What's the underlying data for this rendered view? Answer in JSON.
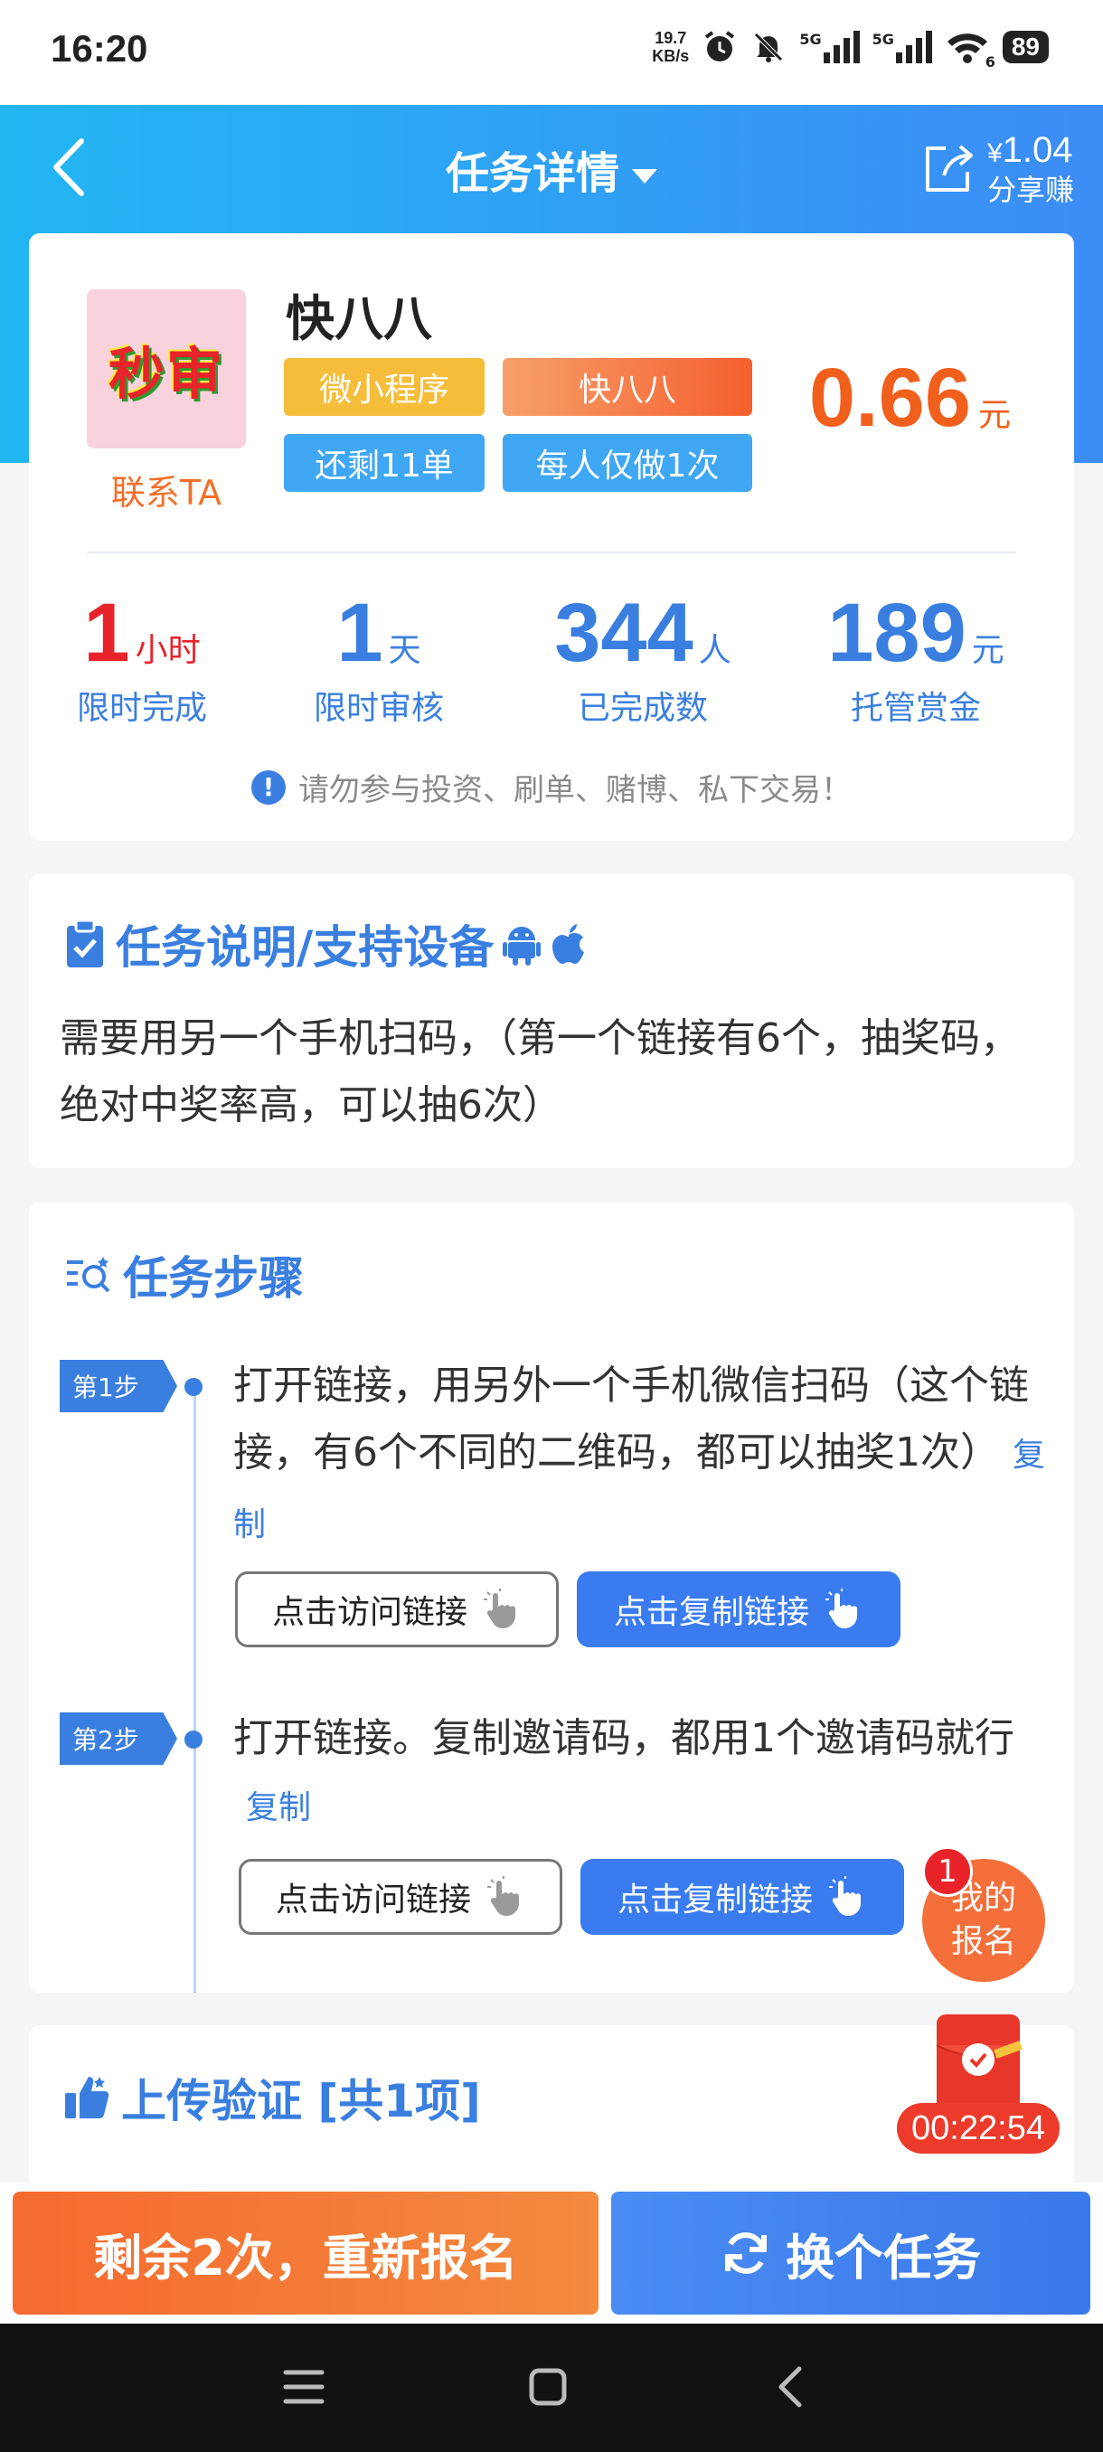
{
  "status": {
    "time": "16:20",
    "speed_value": "19.7",
    "speed_unit": "KB/s",
    "sim1": "5G",
    "sim2": "5G",
    "wifi_label": "6",
    "battery": "89"
  },
  "header": {
    "title": "任务详情",
    "share_currency": "¥",
    "share_amount": "1.04",
    "share_label": "分享赚"
  },
  "task": {
    "logo_text": "秒审",
    "contact_label": "联系TA",
    "name": "快八八",
    "tags": [
      "微小程序",
      "快八八",
      "还剩11单",
      "每人仅做1次"
    ],
    "price": "0.66",
    "price_unit": "元",
    "stats": [
      {
        "value": "1",
        "unit": "小时",
        "label": "限时完成",
        "color": "#e8232a"
      },
      {
        "value": "1",
        "unit": "天",
        "label": "限时审核",
        "color": "#3a7fe0"
      },
      {
        "value": "344",
        "unit": "人",
        "label": "已完成数",
        "color": "#3a7fe0"
      },
      {
        "value": "189",
        "unit": "元",
        "label": "托管赏金",
        "color": "#3a7fe0"
      }
    ],
    "warning": "请勿参与投资、刷单、赌博、私下交易！"
  },
  "description": {
    "title": "任务说明/支持设备",
    "text": "需要用另一个手机扫码，（第一个链接有6个，抽奖码，绝对中奖率高，可以抽6次）"
  },
  "steps": {
    "title": "任务步骤",
    "items": [
      {
        "badge": "第1步",
        "text": "打开链接，用另外一个手机微信扫码（这个链接，有6个不同的二维码，都可以抽奖1次）",
        "copy": "复制",
        "visit_btn": "点击访问链接",
        "copy_btn": "点击复制链接"
      },
      {
        "badge": "第2步",
        "text": "打开链接。复制邀请码，都用1个邀请码就行",
        "copy": "复制",
        "visit_btn": "点击访问链接",
        "copy_btn": "点击复制链接"
      }
    ]
  },
  "upload": {
    "title": "上传验证 [共1项]"
  },
  "floating": {
    "badge_count": "1",
    "register_label": "我的报名",
    "timer": "00:22:54"
  },
  "bottom": {
    "left_label": "剩余2次，重新报名",
    "right_label": "换个任务"
  },
  "colors": {
    "primary": "#3a7fe0",
    "accent_orange": "#f15f1c",
    "header_gradient_start": "#22b6f3",
    "header_gradient_end": "#3c8cf5"
  }
}
